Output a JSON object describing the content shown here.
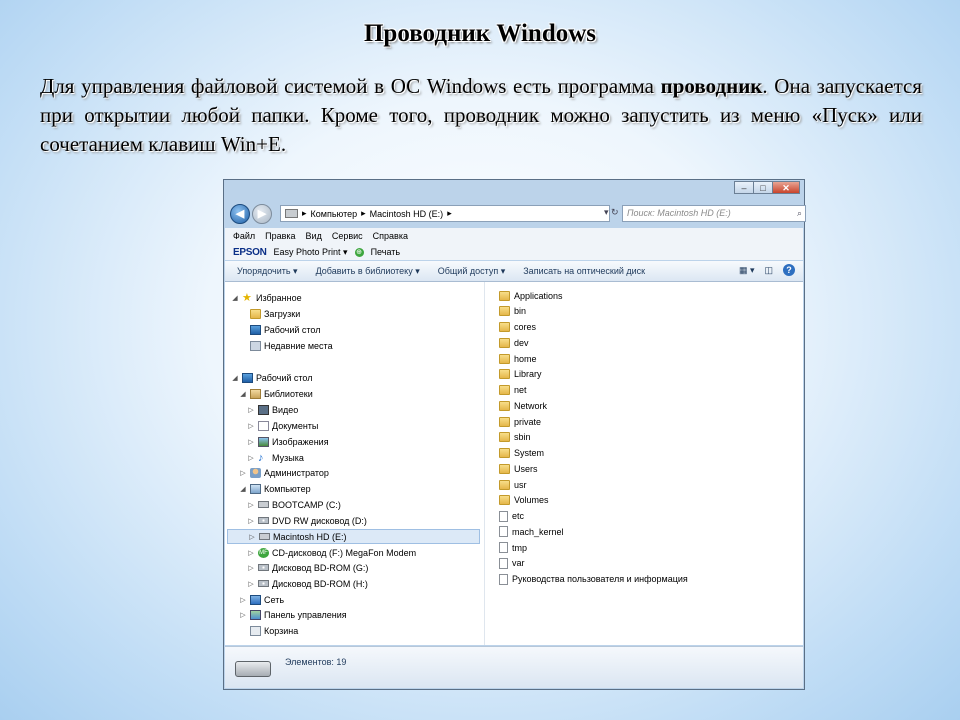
{
  "slide": {
    "title": "Проводник Windows",
    "para_pre": "Для управления файловой системой в ОС Windows есть программа ",
    "para_bold": "проводник",
    "para_post": ". Она запускается при открытии любой папки. Кроме того, проводник можно запустить из меню «Пуск» или сочетанием клавиш Win+E."
  },
  "window": {
    "controls": {
      "minimize": "–",
      "maximize": "□",
      "close": "✕"
    },
    "nav_buttons": {
      "back": "◀",
      "forward": "▶"
    },
    "address": {
      "segments": [
        "Компьютер",
        "Macintosh HD (E:)"
      ],
      "sep": "▸",
      "tools": "▾ ↻"
    },
    "search_placeholder": "Поиск: Macintosh HD (E:)",
    "search_icon": "⌕",
    "menu": [
      "Файл",
      "Правка",
      "Вид",
      "Сервис",
      "Справка"
    ],
    "epson": {
      "logo": "EPSON",
      "app": "Easy Photo Print ▾",
      "print_icon": "⊕",
      "print": "Печать"
    },
    "commands": [
      "Упорядочить ▾",
      "Добавить в библиотеку ▾",
      "Общий доступ ▾",
      "Записать на оптический диск"
    ],
    "cmd_right": {
      "views": "▦ ▾",
      "pane": "◫",
      "help": "?"
    },
    "tree": [
      {
        "label": "Избранное",
        "icon": "star-icon",
        "indent": 0,
        "arrow": "◢"
      },
      {
        "label": "Загрузки",
        "icon": "downloads-folder-icon",
        "indent": 1,
        "arrow": ""
      },
      {
        "label": "Рабочий стол",
        "icon": "desktop-icon",
        "indent": 1,
        "arrow": ""
      },
      {
        "label": "Недавние места",
        "icon": "recent-places-icon",
        "indent": 1,
        "arrow": ""
      },
      {
        "label": "Рабочий стол",
        "icon": "desktop-icon",
        "indent": 0,
        "arrow": "◢"
      },
      {
        "label": "Библиотеки",
        "icon": "libraries-icon",
        "indent": 1,
        "arrow": "◢"
      },
      {
        "label": "Видео",
        "icon": "video-library-icon",
        "indent": 2,
        "arrow": "▷"
      },
      {
        "label": "Документы",
        "icon": "documents-library-icon",
        "indent": 2,
        "arrow": "▷"
      },
      {
        "label": "Изображения",
        "icon": "pictures-library-icon",
        "indent": 2,
        "arrow": "▷"
      },
      {
        "label": "Музыка",
        "icon": "music-library-icon",
        "indent": 2,
        "arrow": "▷"
      },
      {
        "label": "Администратор",
        "icon": "user-folder-icon",
        "indent": 1,
        "arrow": "▷"
      },
      {
        "label": "Компьютер",
        "icon": "computer-icon",
        "indent": 1,
        "arrow": "◢"
      },
      {
        "label": "BOOTCAMP (C:)",
        "icon": "drive-icon",
        "indent": 2,
        "arrow": "▷"
      },
      {
        "label": "DVD RW дисковод (D:)",
        "icon": "dvd-drive-icon",
        "indent": 2,
        "arrow": "▷"
      },
      {
        "label": "Macintosh HD (E:)",
        "icon": "drive-icon",
        "indent": 2,
        "arrow": "▷",
        "selected": true
      },
      {
        "label": "CD-дисковод (F:) MegaFon Modem",
        "icon": "megafon-modem-icon",
        "indent": 2,
        "arrow": "▷"
      },
      {
        "label": "Дисковод BD-ROM (G:)",
        "icon": "dvd-drive-icon",
        "indent": 2,
        "arrow": "▷"
      },
      {
        "label": "Дисковод BD-ROM (H:)",
        "icon": "dvd-drive-icon",
        "indent": 2,
        "arrow": "▷"
      },
      {
        "label": "Сеть",
        "icon": "network-icon",
        "indent": 1,
        "arrow": "▷"
      },
      {
        "label": "Панель управления",
        "icon": "control-panel-icon",
        "indent": 1,
        "arrow": "▷"
      },
      {
        "label": "Корзина",
        "icon": "recycle-bin-icon",
        "indent": 1,
        "arrow": ""
      }
    ],
    "files": [
      {
        "name": "Applications",
        "type": "folder"
      },
      {
        "name": "bin",
        "type": "folder"
      },
      {
        "name": "cores",
        "type": "folder"
      },
      {
        "name": "dev",
        "type": "folder"
      },
      {
        "name": "home",
        "type": "folder"
      },
      {
        "name": "Library",
        "type": "folder"
      },
      {
        "name": "net",
        "type": "folder"
      },
      {
        "name": "Network",
        "type": "folder"
      },
      {
        "name": "private",
        "type": "folder"
      },
      {
        "name": "sbin",
        "type": "folder"
      },
      {
        "name": "System",
        "type": "folder"
      },
      {
        "name": "Users",
        "type": "folder"
      },
      {
        "name": "usr",
        "type": "folder"
      },
      {
        "name": "Volumes",
        "type": "folder"
      },
      {
        "name": "etc",
        "type": "file"
      },
      {
        "name": "mach_kernel",
        "type": "file"
      },
      {
        "name": "tmp",
        "type": "file"
      },
      {
        "name": "var",
        "type": "file"
      },
      {
        "name": "Руководства пользователя и информация",
        "type": "file"
      }
    ],
    "status": "Элементов: 19"
  }
}
